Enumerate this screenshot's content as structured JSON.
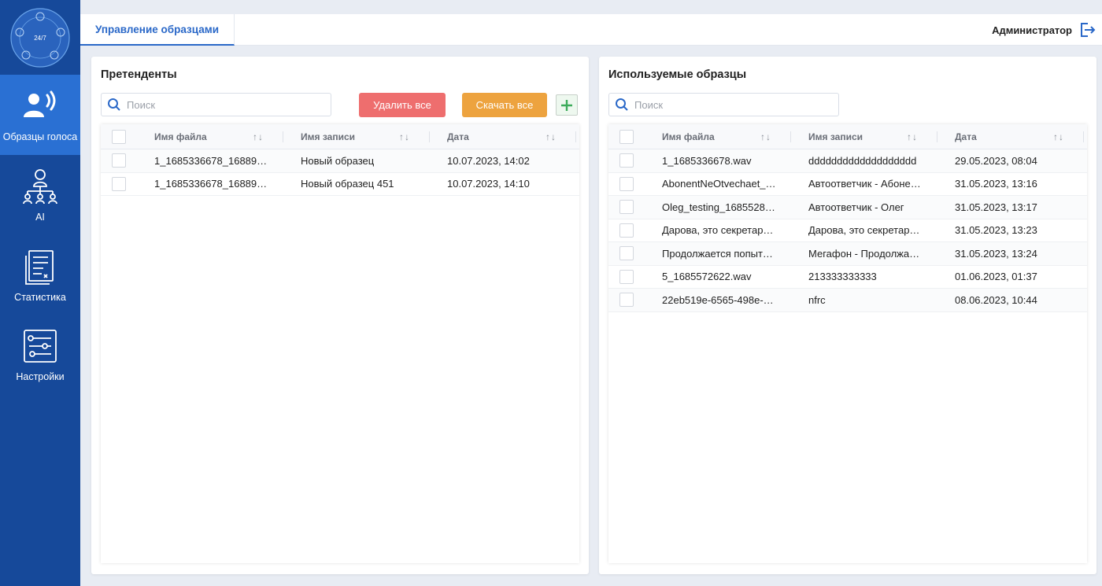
{
  "sidebar": {
    "logo_text": "24/7",
    "items": [
      {
        "label": "Образцы голоса",
        "icon": "voice-icon",
        "active": true
      },
      {
        "label": "AI",
        "icon": "ai-network-icon",
        "active": false
      },
      {
        "label": "Статистика",
        "icon": "statistics-icon",
        "active": false
      },
      {
        "label": "Настройки",
        "icon": "settings-sliders-icon",
        "active": false
      }
    ]
  },
  "header": {
    "tab": "Управление образцами",
    "user": "Администратор"
  },
  "candidates": {
    "title": "Претенденты",
    "search_placeholder": "Поиск",
    "delete_all": "Удалить все",
    "download_all": "Скачать все",
    "columns": [
      "Имя файла",
      "Имя записи",
      "Дата"
    ],
    "sort_glyph": "↑↓",
    "rows": [
      [
        "1_1685336678_16889…",
        "Новый образец",
        "10.07.2023, 14:02"
      ],
      [
        "1_1685336678_16889…",
        "Новый образец 451",
        "10.07.2023, 14:10"
      ]
    ]
  },
  "used": {
    "title": "Используемые образцы",
    "search_placeholder": "Поиск",
    "columns": [
      "Имя файла",
      "Имя записи",
      "Дата"
    ],
    "sort_glyph": "↑↓",
    "rows": [
      [
        "1_1685336678.wav",
        "ddddddddddddddddddd",
        "29.05.2023, 08:04"
      ],
      [
        "AbonentNeOtvechaet_…",
        "Автоответчик - Абоне…",
        "31.05.2023, 13:16"
      ],
      [
        "Oleg_testing_1685528…",
        "Автоответчик - Олег",
        "31.05.2023, 13:17"
      ],
      [
        "Дарова, это секретар…",
        "Дарова, это секретар…",
        "31.05.2023, 13:23"
      ],
      [
        "Продолжается попыт…",
        "Мегафон - Продолжа…",
        "31.05.2023, 13:24"
      ],
      [
        "5_1685572622.wav",
        "213333333333",
        "01.06.2023, 01:37"
      ],
      [
        "22eb519e-6565-498e-…",
        "nfrc",
        "08.06.2023, 10:44"
      ]
    ]
  },
  "colors": {
    "sidebar": "#16499a",
    "sidebar_active": "#2a70d3",
    "accent": "#2a68c8",
    "delete": "#ee6e6e",
    "download": "#eda33f"
  }
}
